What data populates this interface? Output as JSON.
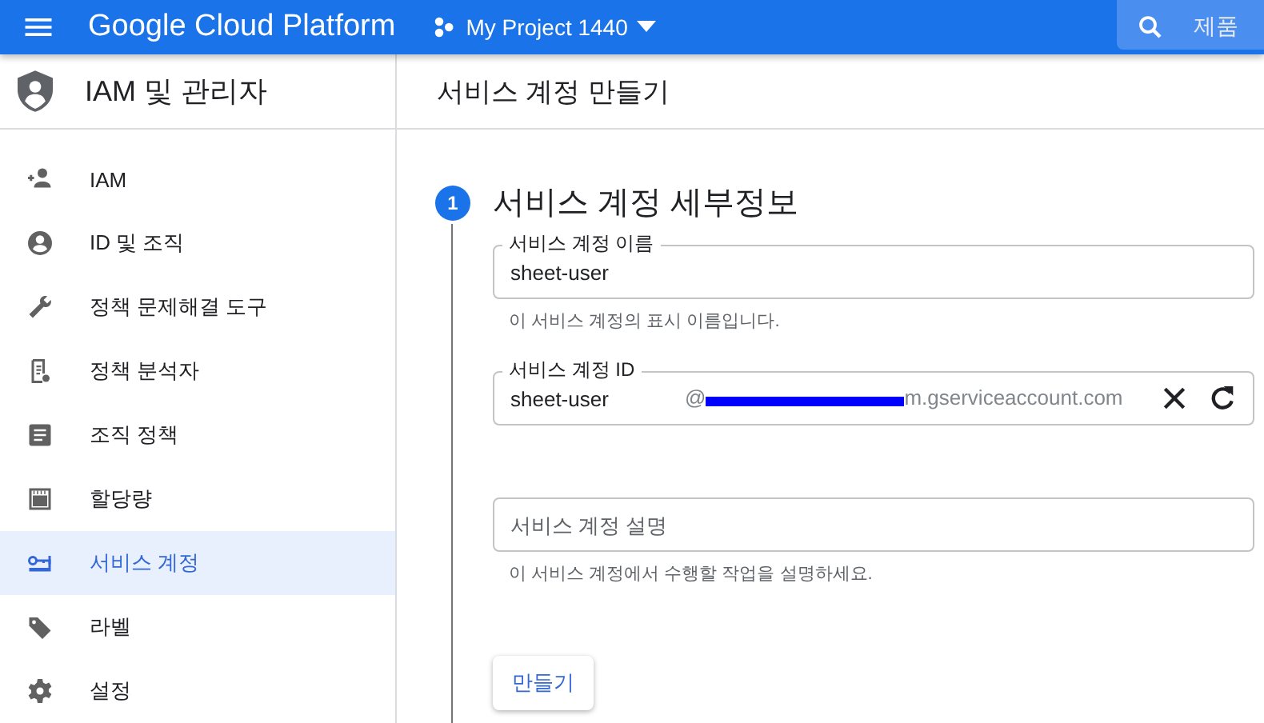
{
  "topbar": {
    "brand": "Google Cloud Platform",
    "project": "My Project 1440",
    "search_label": "제품"
  },
  "sidebar": {
    "title": "IAM 및 관리자",
    "items": [
      {
        "label": "IAM",
        "selected": false
      },
      {
        "label": "ID 및 조직",
        "selected": false
      },
      {
        "label": "정책 문제해결 도구",
        "selected": false
      },
      {
        "label": "정책 분석자",
        "selected": false
      },
      {
        "label": "조직 정책",
        "selected": false
      },
      {
        "label": "할당량",
        "selected": false
      },
      {
        "label": "서비스 계정",
        "selected": true
      },
      {
        "label": "라벨",
        "selected": false
      },
      {
        "label": "설정",
        "selected": false
      }
    ]
  },
  "page": {
    "title": "서비스 계정 만들기",
    "step": {
      "number": "1",
      "title": "서비스 계정 세부정보"
    },
    "fields": [
      {
        "kind": "text",
        "label": "서비스 계정 이름",
        "value": "sheet-user",
        "helper": "이 서비스 계정의 표시 이름입니다."
      },
      {
        "kind": "id",
        "label": "서비스 계정 ID",
        "value": "sheet-user",
        "suffix_start": "@",
        "suffix_end": "m.gserviceaccount.com"
      },
      {
        "kind": "text",
        "placeholder": "서비스 계정 설명",
        "helper": "이 서비스 계정에서 수행할 작업을 설명하세요."
      }
    ],
    "button": "만들기"
  }
}
